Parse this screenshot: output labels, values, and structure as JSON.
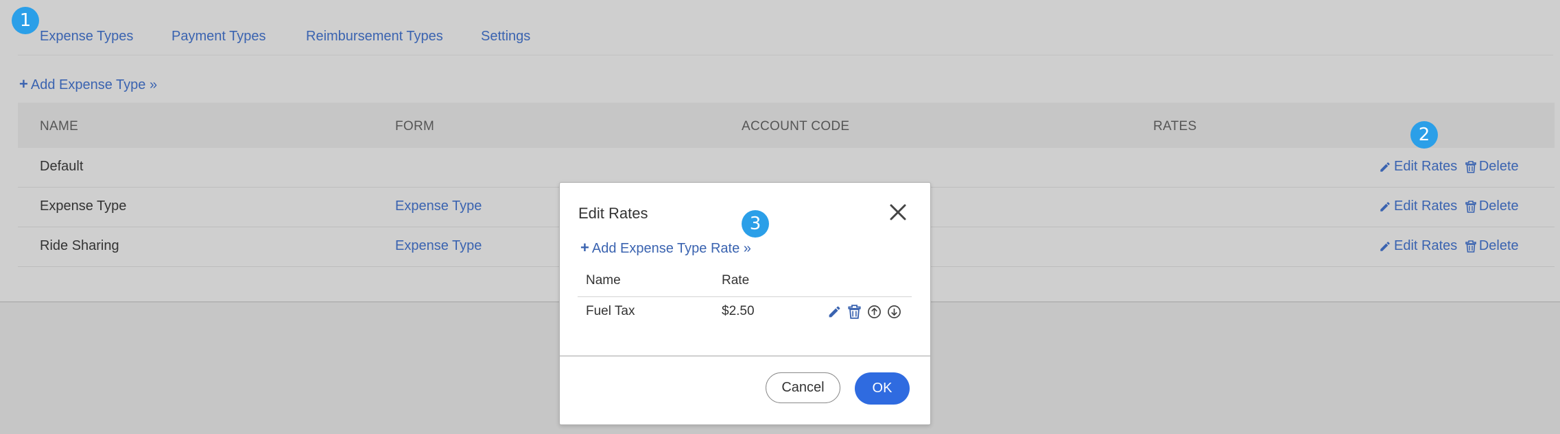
{
  "tabs": [
    {
      "label": "Expense Types",
      "active": true
    },
    {
      "label": "Payment Types"
    },
    {
      "label": "Reimbursement Types"
    },
    {
      "label": "Settings"
    }
  ],
  "add_expense_type": "Add Expense Type »",
  "table": {
    "headers": [
      "NAME",
      "FORM",
      "ACCOUNT CODE",
      "RATES"
    ],
    "rows": [
      {
        "name": "Default",
        "form": "",
        "edit": "Edit Rates",
        "delete": "Delete"
      },
      {
        "name": "Expense Type",
        "form": "Expense Type",
        "edit": "Edit Rates",
        "delete": "Delete"
      },
      {
        "name": "Ride Sharing",
        "form": "Expense Type",
        "edit": "Edit Rates",
        "delete": "Delete"
      }
    ]
  },
  "badges": [
    "1",
    "2",
    "3"
  ],
  "modal": {
    "title": "Edit Rates",
    "add_rate": "Add Expense Type Rate »",
    "headers": [
      "Name",
      "Rate"
    ],
    "rows": [
      {
        "name": "Fuel Tax",
        "rate": "$2.50"
      }
    ],
    "cancel": "Cancel",
    "ok": "OK"
  },
  "colors": {
    "link": "#3a63b0",
    "primary": "#2f6be0",
    "badge": "#2b9fe8",
    "overlay": "#c8c8c8"
  },
  "icons": [
    "plus-icon",
    "pencil-icon",
    "trash-icon",
    "close-icon",
    "arrow-up-circle-icon",
    "arrow-down-circle-icon"
  ]
}
